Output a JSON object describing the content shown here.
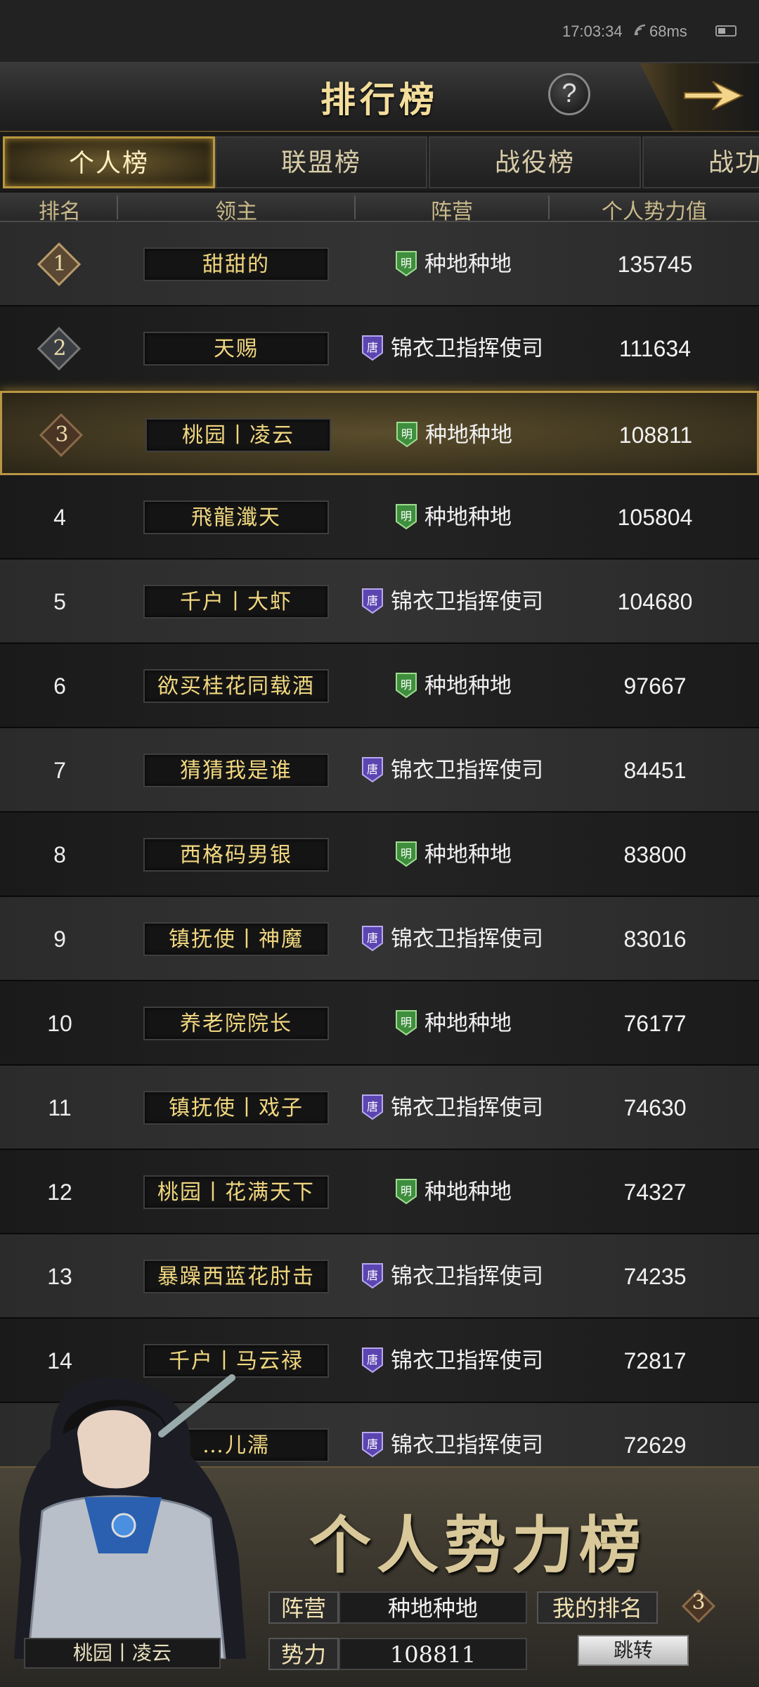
{
  "status_bar": {
    "time": "17:03:34",
    "ping": "68ms"
  },
  "header": {
    "title": "排行榜",
    "help": "?"
  },
  "tabs": [
    {
      "label": "个人榜",
      "active": true
    },
    {
      "label": "联盟榜",
      "active": false
    },
    {
      "label": "战役榜",
      "active": false
    },
    {
      "label": "战功",
      "active": false
    }
  ],
  "columns": {
    "rank": "排名",
    "lord": "领主",
    "camp": "阵营",
    "power": "个人势力值"
  },
  "rows": [
    {
      "rank": "1",
      "lord": "甜甜的",
      "camp": "种地种地",
      "faction": "明",
      "power": "135745"
    },
    {
      "rank": "2",
      "lord": "天赐",
      "camp": "锦衣卫指挥使司",
      "faction": "唐",
      "power": "111634"
    },
    {
      "rank": "3",
      "lord": "桃园丨凌云",
      "camp": "种地种地",
      "faction": "明",
      "power": "108811"
    },
    {
      "rank": "4",
      "lord": "飛龍瀸天",
      "camp": "种地种地",
      "faction": "明",
      "power": "105804"
    },
    {
      "rank": "5",
      "lord": "千户丨大虾",
      "camp": "锦衣卫指挥使司",
      "faction": "唐",
      "power": "104680"
    },
    {
      "rank": "6",
      "lord": "欲买桂花同载酒",
      "camp": "种地种地",
      "faction": "明",
      "power": "97667"
    },
    {
      "rank": "7",
      "lord": "猜猜我是谁",
      "camp": "锦衣卫指挥使司",
      "faction": "唐",
      "power": "84451"
    },
    {
      "rank": "8",
      "lord": "西格码男银",
      "camp": "种地种地",
      "faction": "明",
      "power": "83800"
    },
    {
      "rank": "9",
      "lord": "镇抚使丨神魔",
      "camp": "锦衣卫指挥使司",
      "faction": "唐",
      "power": "83016"
    },
    {
      "rank": "10",
      "lord": "养老院院长",
      "camp": "种地种地",
      "faction": "明",
      "power": "76177"
    },
    {
      "rank": "11",
      "lord": "镇抚使丨戏子",
      "camp": "锦衣卫指挥使司",
      "faction": "唐",
      "power": "74630"
    },
    {
      "rank": "12",
      "lord": "桃园丨花满天下",
      "camp": "种地种地",
      "faction": "明",
      "power": "74327"
    },
    {
      "rank": "13",
      "lord": "暴躁西蓝花肘击",
      "camp": "锦衣卫指挥使司",
      "faction": "唐",
      "power": "74235"
    },
    {
      "rank": "14",
      "lord": "千户丨马云禄",
      "camp": "锦衣卫指挥使司",
      "faction": "唐",
      "power": "72817"
    },
    {
      "rank": "",
      "lord": "…儿濡",
      "camp": "锦衣卫指挥使司",
      "faction": "唐",
      "power": "72629"
    }
  ],
  "footer": {
    "banner": "个人势力榜",
    "camp_label": "阵营",
    "camp_value": "种地种地",
    "my_rank_label": "我的排名",
    "my_rank": "3",
    "power_label": "势力",
    "power_value": "108811",
    "jump_button": "跳转",
    "player_name": "桃园丨凌云"
  },
  "colors": {
    "gold": "#f1d77f",
    "ming_badge": "#4caf50",
    "tang_badge": "#6a4fc4"
  }
}
